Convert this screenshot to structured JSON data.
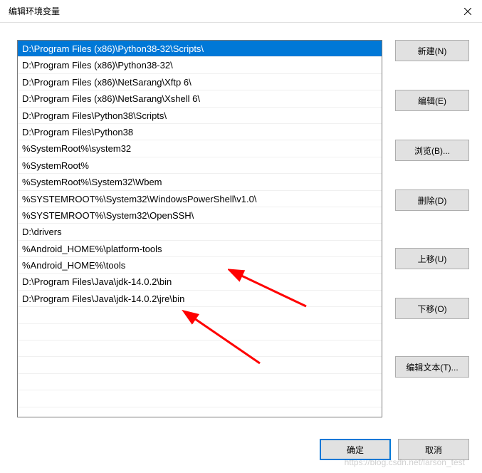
{
  "titlebar": {
    "title": "编辑环境变量"
  },
  "list": {
    "items": [
      "D:\\Program Files (x86)\\Python38-32\\Scripts\\",
      "D:\\Program Files (x86)\\Python38-32\\",
      "D:\\Program Files (x86)\\NetSarang\\Xftp 6\\",
      "D:\\Program Files (x86)\\NetSarang\\Xshell 6\\",
      "D:\\Program Files\\Python38\\Scripts\\",
      "D:\\Program Files\\Python38",
      "%SystemRoot%\\system32",
      "%SystemRoot%",
      "%SystemRoot%\\System32\\Wbem",
      "%SYSTEMROOT%\\System32\\WindowsPowerShell\\v1.0\\",
      "%SYSTEMROOT%\\System32\\OpenSSH\\",
      "D:\\drivers",
      "%Android_HOME%\\platform-tools",
      "%Android_HOME%\\tools",
      "D:\\Program Files\\Java\\jdk-14.0.2\\bin",
      "D:\\Program Files\\Java\\jdk-14.0.2\\jre\\bin"
    ],
    "selected_index": 0
  },
  "buttons": {
    "new": "新建(N)",
    "edit": "编辑(E)",
    "browse": "浏览(B)...",
    "delete": "删除(D)",
    "move_up": "上移(U)",
    "move_down": "下移(O)",
    "edit_text": "编辑文本(T)...",
    "ok": "确定",
    "cancel": "取消"
  },
  "annotations": {
    "arrow_color": "#ff0000"
  },
  "watermark": "https://blog.csdn.net/larson_test"
}
